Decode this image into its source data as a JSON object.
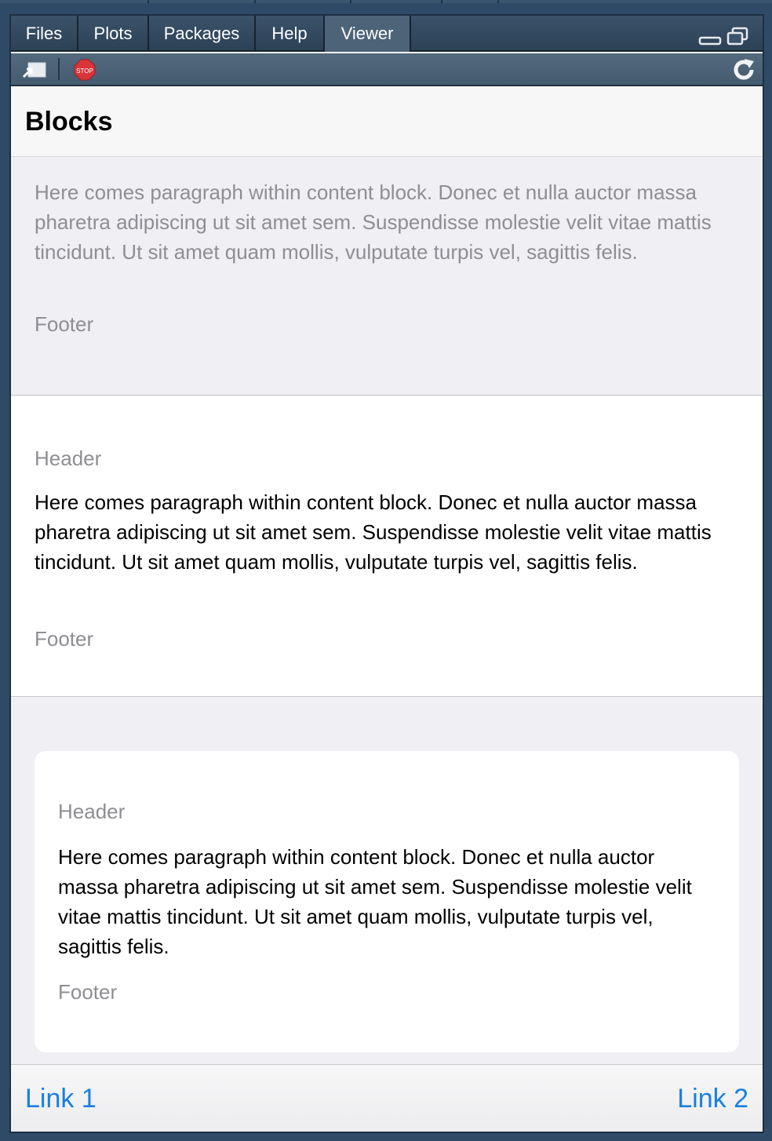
{
  "tabs": [
    {
      "label": "Files"
    },
    {
      "label": "Plots"
    },
    {
      "label": "Packages"
    },
    {
      "label": "Help"
    },
    {
      "label": "Viewer"
    }
  ],
  "active_tab": "Viewer",
  "toolbar": {
    "stop_label": "STOP"
  },
  "page": {
    "title": "Blocks",
    "blocks": [
      {
        "paragraph": "Here comes paragraph within content block. Donec et nulla auctor massa pharetra adipiscing ut sit amet sem. Suspendisse molestie velit vitae mattis tincidunt. Ut sit amet quam mollis, vulputate turpis vel, sagittis felis.",
        "footer": "Footer"
      },
      {
        "header": "Header",
        "paragraph": "Here comes paragraph within content block. Donec et nulla auctor massa pharetra adipiscing ut sit amet sem. Suspendisse molestie velit vitae mattis tincidunt. Ut sit amet quam mollis, vulputate turpis vel, sagittis felis.",
        "footer": "Footer"
      },
      {
        "header": "Header",
        "paragraph": "Here comes paragraph within content block. Donec et nulla auctor massa pharetra adipiscing ut sit amet sem. Suspendisse molestie velit vitae mattis tincidunt. Ut sit amet quam mollis, vulputate turpis vel, sagittis felis.",
        "footer": "Footer"
      }
    ],
    "links": [
      {
        "label": "Link 1"
      },
      {
        "label": "Link 2"
      }
    ]
  },
  "colors": {
    "link": "#1a7fe0",
    "muted_text": "#8e8e93",
    "page_background": "#efeff4"
  }
}
